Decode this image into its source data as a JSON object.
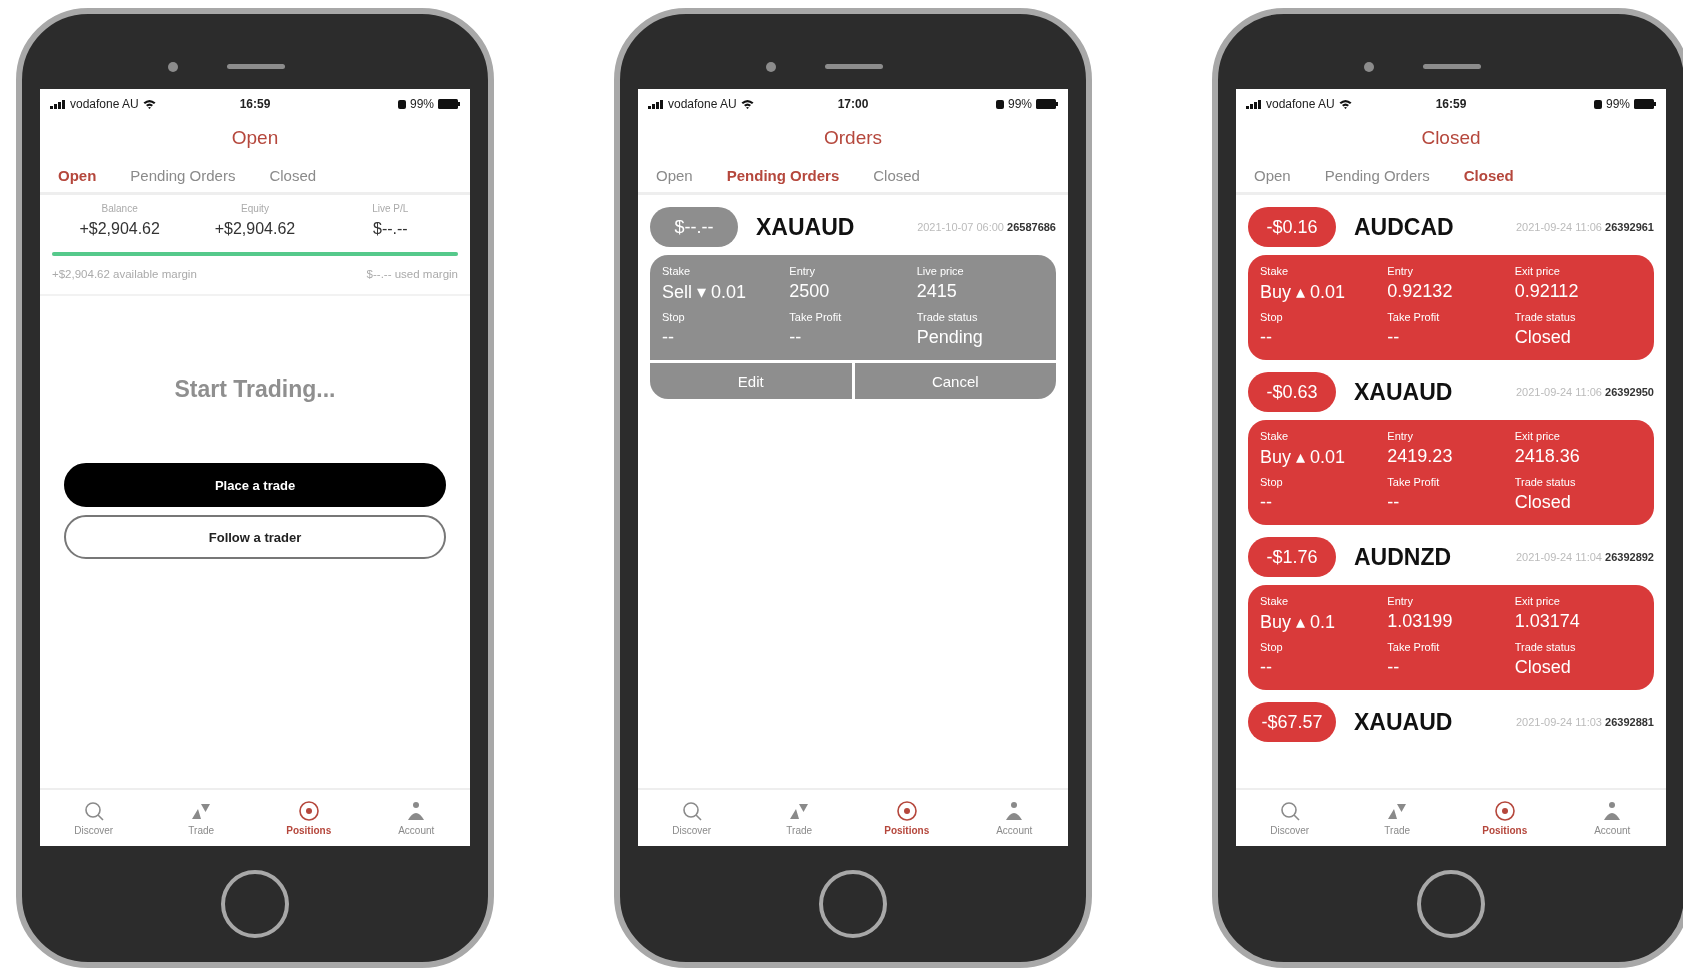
{
  "phones": [
    {
      "kind": "open",
      "status": {
        "carrier": "vodafone AU",
        "time": "16:59",
        "battery": "99%"
      },
      "title": "Open",
      "tabs": [
        {
          "label": "Open",
          "selected": true
        },
        {
          "label": "Pending Orders",
          "selected": false
        },
        {
          "label": "Closed",
          "selected": false
        }
      ],
      "summary": [
        {
          "label": "Balance",
          "value": "+$2,904.62"
        },
        {
          "label": "Equity",
          "value": "+$2,904.62"
        },
        {
          "label": "Live P/L",
          "value": "$--.--"
        }
      ],
      "margin": {
        "level": 1,
        "available": "+$2,904.62 available margin",
        "used": "$--.-- used margin"
      },
      "empty_text": "Start Trading...",
      "buttons": [
        {
          "kind": "primary",
          "label": "Place a trade"
        },
        {
          "kind": "secondary",
          "label": "Follow a trader"
        }
      ],
      "nav": [
        {
          "label": "Discover",
          "selected": false
        },
        {
          "label": "Trade",
          "selected": false
        },
        {
          "label": "Positions",
          "selected": true
        },
        {
          "label": "Account",
          "selected": false
        }
      ]
    },
    {
      "kind": "orders",
      "status": {
        "carrier": "vodafone AU",
        "time": "17:00",
        "battery": "99%"
      },
      "title": "Orders",
      "tabs": [
        {
          "label": "Open",
          "selected": false
        },
        {
          "label": "Pending Orders",
          "selected": true
        },
        {
          "label": "Closed",
          "selected": false
        }
      ],
      "trades": [
        {
          "kind": "pending",
          "pnl": "$--.--",
          "symbol": "XAUAUD",
          "date": "2021-10-07 06:00",
          "id": "26587686",
          "fields": [
            {
              "label": "Stake",
              "value": "Sell ▾ 0.01"
            },
            {
              "label": "Entry",
              "value": "2500"
            },
            {
              "label": "Live price",
              "value": "2415"
            },
            {
              "label": "Stop",
              "value": "--"
            },
            {
              "label": "Take Profit",
              "value": "--"
            },
            {
              "label": "Trade status",
              "value": "Pending"
            }
          ],
          "actions": [
            "Edit",
            "Cancel"
          ]
        }
      ],
      "nav": [
        {
          "label": "Discover",
          "selected": false
        },
        {
          "label": "Trade",
          "selected": false
        },
        {
          "label": "Positions",
          "selected": true
        },
        {
          "label": "Account",
          "selected": false
        }
      ]
    },
    {
      "kind": "closed",
      "status": {
        "carrier": "vodafone AU",
        "time": "16:59",
        "battery": "99%"
      },
      "title": "Closed",
      "tabs": [
        {
          "label": "Open",
          "selected": false
        },
        {
          "label": "Pending Orders",
          "selected": false
        },
        {
          "label": "Closed",
          "selected": true
        }
      ],
      "trades": [
        {
          "kind": "closed",
          "pnl": "-$0.16",
          "symbol": "AUDCAD",
          "date": "2021-09-24 11:06",
          "id": "26392961",
          "fields": [
            {
              "label": "Stake",
              "value": "Buy ▴ 0.01"
            },
            {
              "label": "Entry",
              "value": "0.92132"
            },
            {
              "label": "Exit price",
              "value": "0.92112"
            },
            {
              "label": "Stop",
              "value": "--"
            },
            {
              "label": "Take Profit",
              "value": "--"
            },
            {
              "label": "Trade status",
              "value": "Closed"
            }
          ]
        },
        {
          "kind": "closed",
          "pnl": "-$0.63",
          "symbol": "XAUAUD",
          "date": "2021-09-24 11:06",
          "id": "26392950",
          "fields": [
            {
              "label": "Stake",
              "value": "Buy ▴ 0.01"
            },
            {
              "label": "Entry",
              "value": "2419.23"
            },
            {
              "label": "Exit price",
              "value": "2418.36"
            },
            {
              "label": "Stop",
              "value": "--"
            },
            {
              "label": "Take Profit",
              "value": "--"
            },
            {
              "label": "Trade status",
              "value": "Closed"
            }
          ]
        },
        {
          "kind": "closed",
          "pnl": "-$1.76",
          "symbol": "AUDNZD",
          "date": "2021-09-24 11:04",
          "id": "26392892",
          "fields": [
            {
              "label": "Stake",
              "value": "Buy ▴ 0.1"
            },
            {
              "label": "Entry",
              "value": "1.03199"
            },
            {
              "label": "Exit price",
              "value": "1.03174"
            },
            {
              "label": "Stop",
              "value": "--"
            },
            {
              "label": "Take Profit",
              "value": "--"
            },
            {
              "label": "Trade status",
              "value": "Closed"
            }
          ]
        },
        {
          "kind": "closed",
          "pnl": "-$67.57",
          "symbol": "XAUAUD",
          "date": "2021-09-24 11:03",
          "id": "26392881"
        }
      ],
      "nav": [
        {
          "label": "Discover",
          "selected": false
        },
        {
          "label": "Trade",
          "selected": false
        },
        {
          "label": "Positions",
          "selected": true
        },
        {
          "label": "Account",
          "selected": false
        }
      ]
    }
  ]
}
